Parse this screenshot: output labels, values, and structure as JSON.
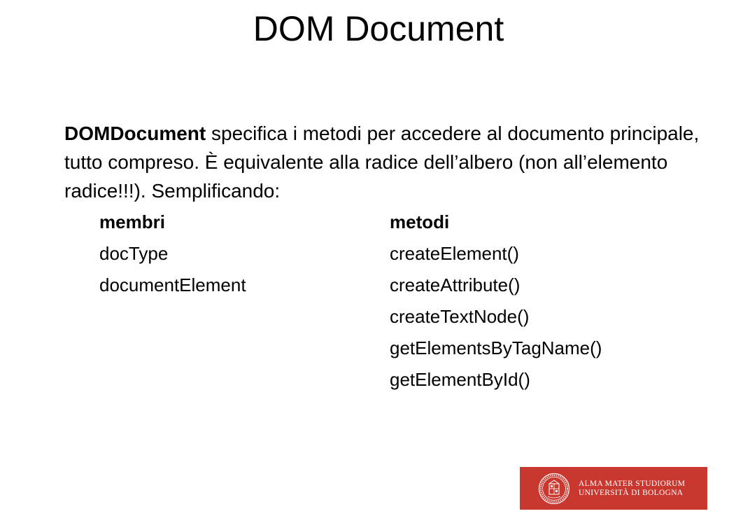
{
  "slide": {
    "title": "DOM Document",
    "intro": {
      "bold_term": "DOMDocument",
      "text": " specifica i metodi per accedere al documento principale, tutto compreso. È equivalente alla radice dell’albero (non all’elemento radice!!!). Semplificando:"
    },
    "members": {
      "header": "membri",
      "items": [
        "docType",
        "documentElement"
      ]
    },
    "methods": {
      "header": "metodi",
      "items": [
        "createElement()",
        "createAttribute()",
        "createTextNode()",
        "getElementsByTagName()",
        "getElementById()"
      ]
    },
    "logo": {
      "line1": "ALMA MATER STUDIORUM",
      "line2": "UNIVERSITÀ DI BOLOGNA",
      "background_color": "#c8382f"
    }
  }
}
